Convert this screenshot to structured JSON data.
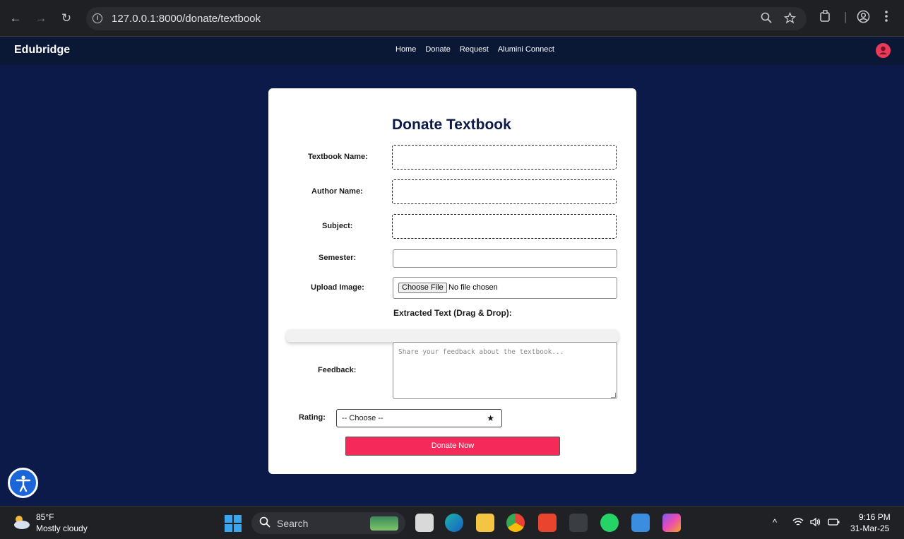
{
  "browser": {
    "url": "127.0.0.1:8000/donate/textbook",
    "back_icon": "←",
    "forward_icon": "→",
    "reload_icon": "↻"
  },
  "navbar": {
    "brand": "Edubridge",
    "links": [
      "Home",
      "Donate",
      "Request",
      "Alumini Connect"
    ]
  },
  "form": {
    "title": "Donate Textbook",
    "textbook_name_label": "Textbook Name:",
    "author_name_label": "Author Name:",
    "subject_label": "Subject:",
    "semester_label": "Semester:",
    "upload_image_label": "Upload Image:",
    "choose_file_label": "Choose File",
    "no_file_text": "No file chosen",
    "extracted_text_label": "Extracted Text (Drag & Drop):",
    "feedback_label": "Feedback:",
    "feedback_placeholder": "Share your feedback about the textbook...",
    "rating_label": "Rating:",
    "rating_value": "-- Choose --",
    "rating_icon": "★",
    "submit_label": "Donate Now"
  },
  "taskbar": {
    "weather_temp": "85°F",
    "weather_desc": "Mostly cloudy",
    "search_label": "Search",
    "time": "9:16 PM",
    "date": "31-Mar-25"
  },
  "colors": {
    "page_bg": "#0b1a48",
    "navbar_bg": "#0a1836",
    "accent": "#f52a5a"
  }
}
